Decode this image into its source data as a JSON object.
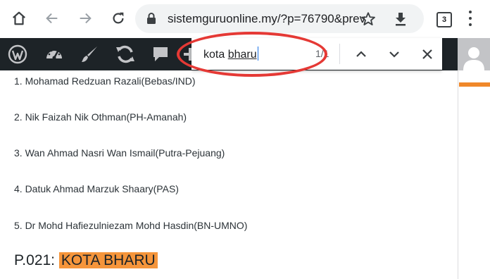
{
  "browser": {
    "url": "sistemguruonline.my/?p=76790&prev",
    "tab_count": "3"
  },
  "find": {
    "query_plain": "kota ",
    "query_underlined": "bharu",
    "count": "1/1"
  },
  "content": {
    "candidates": [
      "1. Mohamad Redzuan Razali(Bebas/IND)",
      "2. Nik Faizah Nik Othman(PH-Amanah)",
      "3. Wan Ahmad Nasri Wan Ismail(Putra-Pejuang)",
      "4. Datuk Ahmad Marzuk Shaary(PAS)",
      "5. Dr Mohd Hafiezulniezam Mohd Hasdin(BN-UMNO)"
    ],
    "heading_prefix": "P.021: ",
    "heading_highlight": "KOTA BHARU"
  },
  "colors": {
    "admin_bar": "#1d2327",
    "highlight": "#f5953b",
    "annotation": "#e53935",
    "accent_bar": "#f0882a"
  },
  "icons": {
    "toolbar": [
      "home-icon",
      "back-icon",
      "forward-icon",
      "reload-icon",
      "lock-icon",
      "star-icon",
      "download-icon",
      "tab-switcher-icon",
      "menu-icon"
    ],
    "admin_bar": [
      "wordpress-icon",
      "dashboard-icon",
      "customize-brush-icon",
      "updates-icon",
      "comments-icon",
      "new-plus-icon",
      "avatar-icon"
    ],
    "find_bar": [
      "chevron-up-icon",
      "chevron-down-icon",
      "close-icon"
    ]
  }
}
